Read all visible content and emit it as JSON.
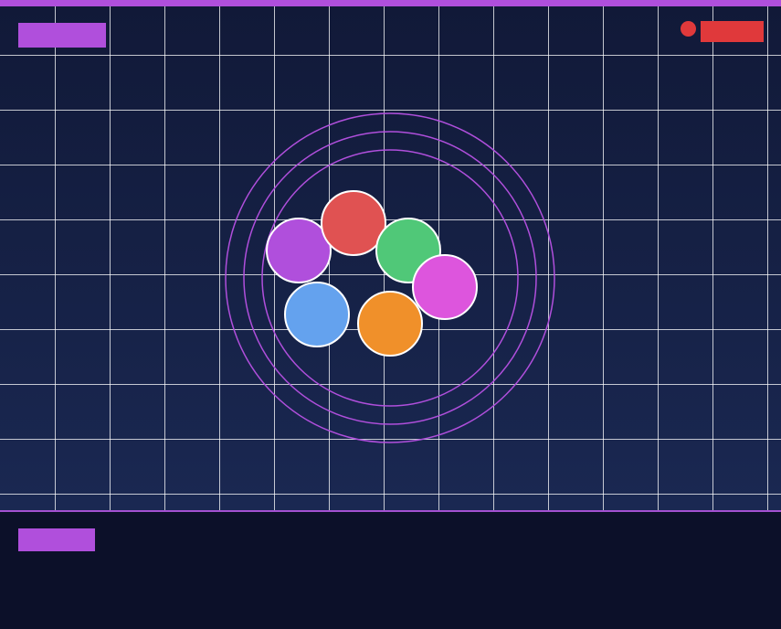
{
  "hud": {
    "title_label": "",
    "record_label": ""
  },
  "panel": {
    "button_label": ""
  },
  "colors": {
    "accent": "#b04fdc",
    "record": "#e0393b",
    "grid_line": "#ffffff",
    "ring": "#b04fdc",
    "ball_outline": "#ffffff"
  },
  "rings": [
    {
      "name": "outer-ring"
    },
    {
      "name": "middle-ring"
    },
    {
      "name": "inner-ring"
    }
  ],
  "balls": [
    {
      "name": "purple-ball",
      "color": "#b04fdc"
    },
    {
      "name": "red-ball",
      "color": "#e05252"
    },
    {
      "name": "green-ball",
      "color": "#50c878"
    },
    {
      "name": "magenta-ball",
      "color": "#dd55dd"
    },
    {
      "name": "blue-ball",
      "color": "#64a2ee"
    },
    {
      "name": "orange-ball",
      "color": "#f0902a"
    }
  ]
}
